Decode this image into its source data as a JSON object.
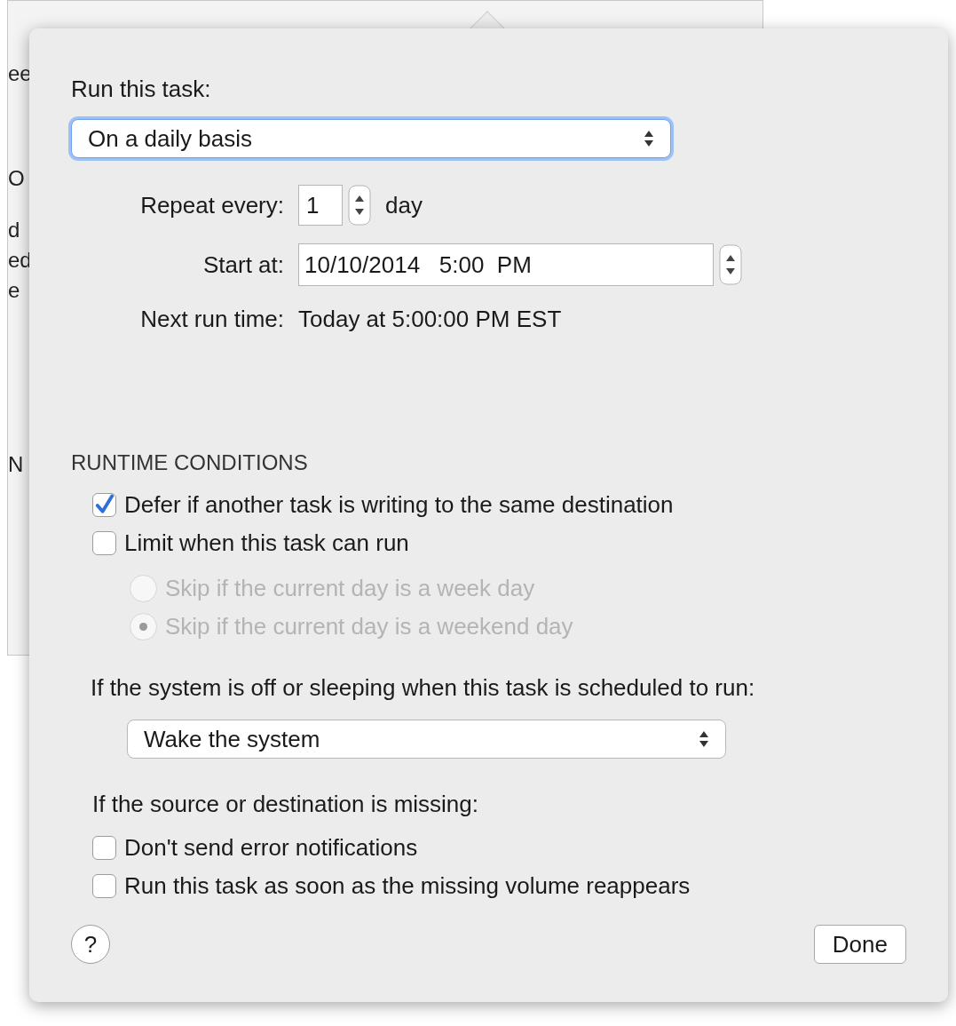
{
  "background_window": {
    "fragments": [
      "ee",
      "O",
      "d",
      "ed",
      "e",
      "N"
    ]
  },
  "schedule": {
    "label": "Run this task:",
    "value": "On a daily basis"
  },
  "repeat": {
    "label": "Repeat every:",
    "value": "1",
    "unit": "day"
  },
  "start": {
    "label": "Start at:",
    "value": "10/10/2014   5:00  PM"
  },
  "next_run": {
    "label": "Next run time:",
    "value": "Today at 5:00:00 PM EST"
  },
  "conditions": {
    "heading": "RUNTIME CONDITIONS",
    "options": [
      {
        "kind": "checkbox",
        "label": "Defer if another task is writing to the same destination",
        "checked": true,
        "disabled": false
      },
      {
        "kind": "checkbox",
        "label": "Limit when this task can run",
        "checked": false,
        "disabled": false,
        "children": [
          {
            "kind": "radio",
            "label": "Skip if the current day is a week day",
            "selected": false,
            "disabled": true
          },
          {
            "kind": "radio",
            "label": "Skip if the current day is a weekend day",
            "selected": true,
            "disabled": true
          }
        ]
      }
    ]
  },
  "sleep": {
    "label": "If the system is off or sleeping when this task is scheduled to run:",
    "value": "Wake the system"
  },
  "missing": {
    "label": "If the source or destination is missing:",
    "options": [
      {
        "kind": "checkbox",
        "label": "Don't send error notifications",
        "checked": false,
        "disabled": false
      },
      {
        "kind": "checkbox",
        "label": "Run this task as soon as the missing volume reappears",
        "checked": false,
        "disabled": false
      }
    ]
  },
  "help": "?",
  "done": "Done"
}
